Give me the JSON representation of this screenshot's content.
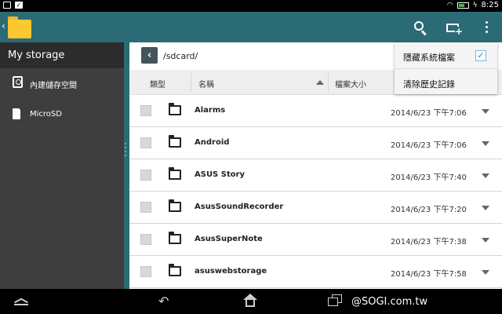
{
  "status_bar": {
    "time": "8:25",
    "wifi_icon": "wifi-icon",
    "battery_icon": "battery-charging-icon"
  },
  "app_bar": {
    "app_icon": "folder-icon",
    "actions": [
      "search-icon",
      "new-folder-icon",
      "overflow-menu-icon"
    ]
  },
  "sidebar": {
    "title": "My storage",
    "items": [
      {
        "label": "內建儲存空間",
        "icon": "internal-storage-icon"
      },
      {
        "label": "MicroSD",
        "icon": "sd-card-icon"
      }
    ]
  },
  "path_bar": {
    "path": "/sdcard/"
  },
  "table": {
    "headers": {
      "type": "類型",
      "name": "名稱",
      "size": "檔案大小"
    },
    "rows": [
      {
        "name": "Alarms",
        "date": "2014/6/23 下午7:06"
      },
      {
        "name": "Android",
        "date": "2014/6/23 下午7:06"
      },
      {
        "name": "ASUS Story",
        "date": "2014/6/23 下午7:40"
      },
      {
        "name": "AsusSoundRecorder",
        "date": "2014/6/23 下午7:20"
      },
      {
        "name": "AsusSuperNote",
        "date": "2014/6/23 下午7:38"
      },
      {
        "name": "asuswebstorage",
        "date": "2014/6/23 下午7:58"
      }
    ]
  },
  "dropdown": {
    "items": [
      {
        "label": "隱藏系統檔案",
        "checked": true
      },
      {
        "label": "清除歷史記錄"
      }
    ]
  },
  "watermark": "@SOGI.com.tw",
  "colors": {
    "toolbar": "#2b6b75",
    "sidebar": "#3e3e3e",
    "sidebar_title": "#2c2c2c",
    "folder": "#fcc72f"
  }
}
